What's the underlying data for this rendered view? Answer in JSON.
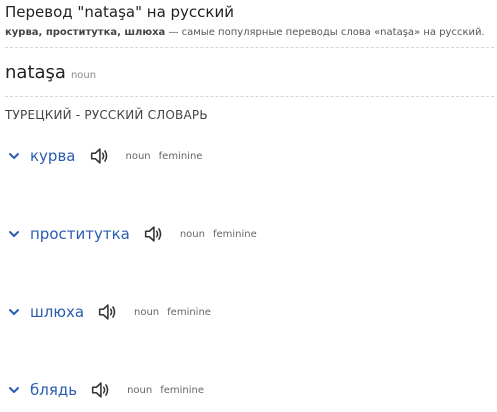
{
  "header": {
    "title": "Перевод \"nataşa\" на русский",
    "subtitle_bold": "курва, проститутка, шлюха",
    "subtitle_rest": " — самые популярные переводы слова «nataşa» на русский."
  },
  "headword": {
    "text": "nataşa",
    "pos": "noun"
  },
  "dictionary": {
    "title": "ТУРЕЦКИЙ - РУССКИЙ СЛОВАРЬ",
    "entries": [
      {
        "word": "курва",
        "pos": "noun",
        "gender": "feminine"
      },
      {
        "word": "проститутка",
        "pos": "noun",
        "gender": "feminine"
      },
      {
        "word": "шлюха",
        "pos": "noun",
        "gender": "feminine"
      },
      {
        "word": "блядь",
        "pos": "noun",
        "gender": "feminine"
      }
    ]
  },
  "icons": {
    "expand": "chevron-down-icon",
    "audio": "speaker-icon"
  },
  "colors": {
    "link": "#2a5db0",
    "text": "#222222",
    "muted": "#666666",
    "divider": "#d6d6d6"
  }
}
